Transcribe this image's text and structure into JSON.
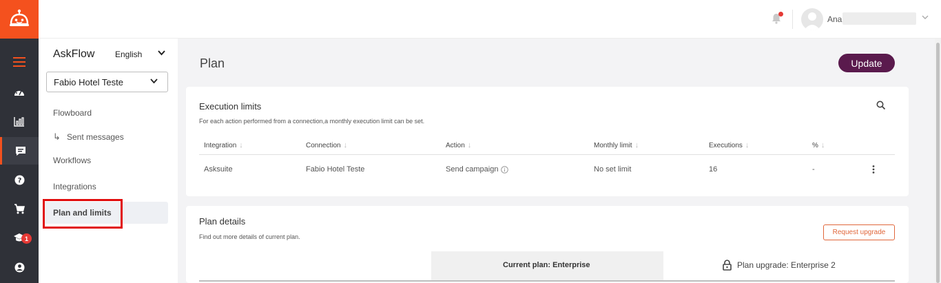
{
  "rail": {
    "notifications_badge": "1",
    "accent_color": "#f4511e",
    "items": [
      "menu-icon",
      "dashboard-icon",
      "chart-icon",
      "chat-icon",
      "help-icon",
      "cart-icon",
      "graduation-cap-icon",
      "account-icon"
    ]
  },
  "topbar": {
    "user_name": "Ana"
  },
  "sidebar": {
    "app_name": "AskFlow",
    "language": "English",
    "selected_hotel": "Fabio Hotel Teste",
    "items": {
      "flowboard": "Flowboard",
      "sent_messages": "Sent messages",
      "workflows": "Workflows",
      "integrations": "Integrations",
      "plan_and_limits": "Plan and limits"
    }
  },
  "page": {
    "title": "Plan",
    "update_label": "Update"
  },
  "execution_limits": {
    "title": "Execution limits",
    "subtitle": "For each action performed from a connection,a monthly execution limit can be set.",
    "columns": [
      "Integration",
      "Connection",
      "Action",
      "Monthly limit",
      "Executions",
      "%"
    ],
    "row": {
      "integration": "Asksuite",
      "connection": "Fabio Hotel Teste",
      "action": "Send campaign",
      "monthly_limit": "No set limit",
      "executions": "16",
      "percent": "-"
    }
  },
  "plan_details": {
    "title": "Plan details",
    "subtitle": "Find out more details of current plan.",
    "request_upgrade_label": "Request upgrade",
    "current_plan": "Current plan: Enterprise",
    "plan_upgrade": "Plan upgrade: Enterprise 2"
  }
}
